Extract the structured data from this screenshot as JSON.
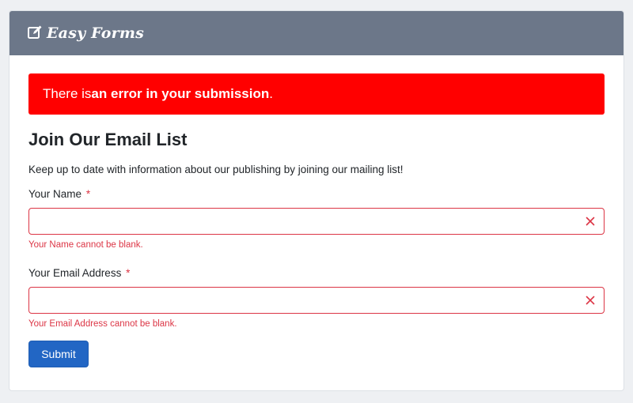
{
  "header": {
    "brand": "Easy Forms",
    "brand_icon": "edit-square-icon",
    "background": "#6c7789"
  },
  "alert": {
    "prefix": "There is ",
    "emphasis": "an error in your submission",
    "suffix": ".",
    "color": "#ff0000"
  },
  "form": {
    "title": "Join Our Email List",
    "description": "Keep up to date with information about our publishing by joining our mailing list!",
    "required_mark": "*",
    "fields": [
      {
        "label": "Your Name",
        "value": "",
        "placeholder": "",
        "error": "Your Name cannot be blank.",
        "clear_icon": "close-icon"
      },
      {
        "label": "Your Email Address",
        "value": "",
        "placeholder": "",
        "error": "Your Email Address cannot be blank.",
        "clear_icon": "close-icon"
      }
    ],
    "submit_label": "Submit",
    "error_color": "#dc3545",
    "button_color": "#2266c4"
  }
}
